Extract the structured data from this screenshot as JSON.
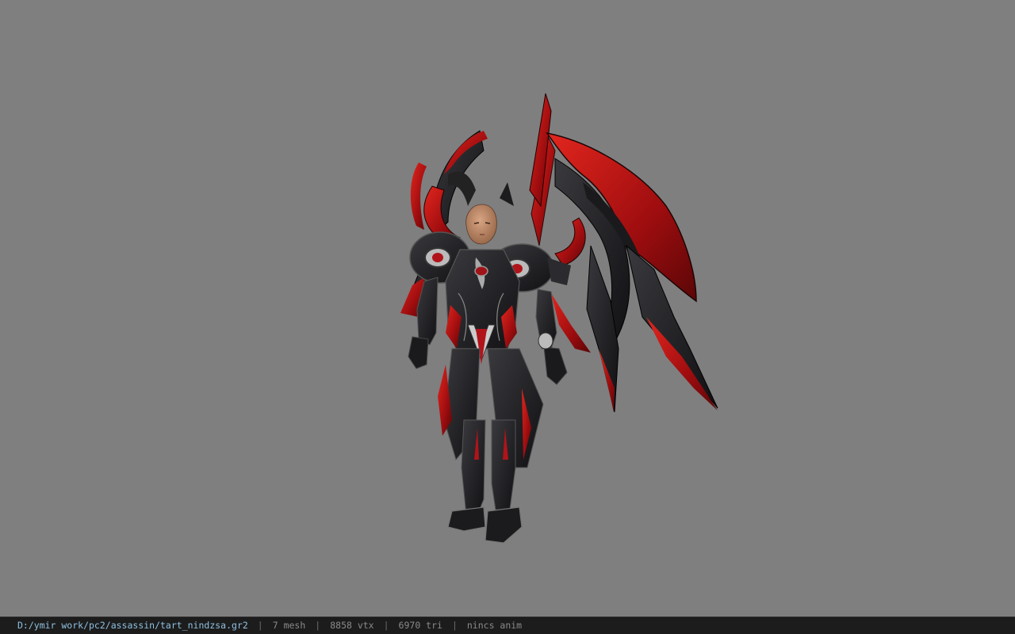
{
  "viewport": {
    "background_color": "#7f7f7f",
    "model_description_icon": "armored-character-model"
  },
  "statusbar": {
    "file_path": "D:/ymir work/pc2/assassin/tart_nindzsa.gr2",
    "separator": "|",
    "mesh": "7 mesh",
    "vtx": "8858 vtx",
    "tri": "6970 tri",
    "anim": "nincs anim"
  },
  "colors": {
    "status_bg": "#1c1c1c",
    "path_color": "#8fc0e0",
    "armor_red": "#c0141a",
    "armor_dark": "#1a1a1c"
  }
}
